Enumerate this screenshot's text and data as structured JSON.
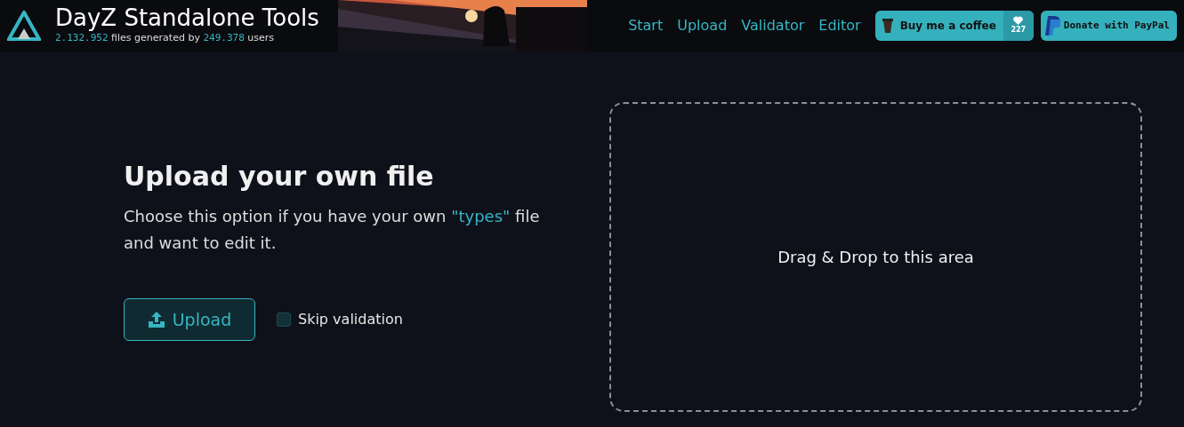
{
  "header": {
    "title": "DayZ Standalone Tools",
    "stats": {
      "files": "2.132.952",
      "files_text": "files generated by",
      "users": "249.378",
      "users_text": "users"
    }
  },
  "nav": [
    {
      "label": "Start"
    },
    {
      "label": "Upload"
    },
    {
      "label": "Validator"
    },
    {
      "label": "Editor"
    }
  ],
  "coffee_button": {
    "label": "Buy me a coffee",
    "count": "227"
  },
  "paypal_button": {
    "label": "Donate with PayPal"
  },
  "upload_section": {
    "title": "Upload your own file",
    "description": "Choose this option if you have your own ",
    "link": "\"types\"",
    "description_end": " file and want to edit it.",
    "button": "Upload",
    "skip_validation": {
      "label": "Skip validation",
      "checked": false
    }
  },
  "dropzone": {
    "text": "Drag & Drop to this area"
  }
}
